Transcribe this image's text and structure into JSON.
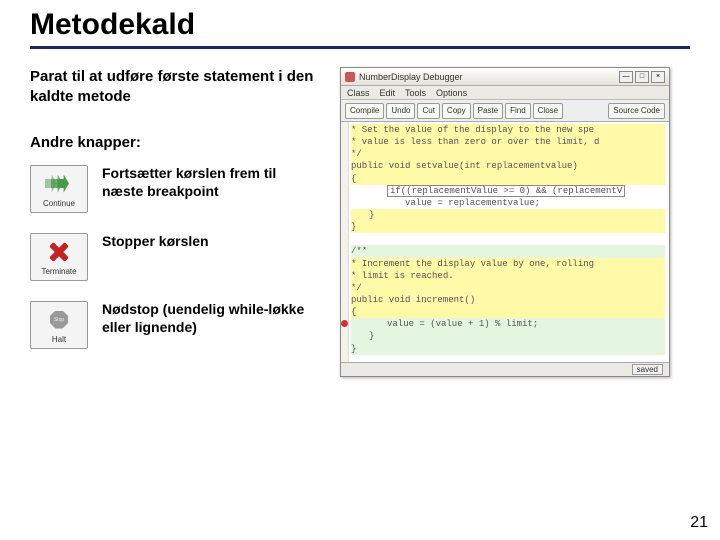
{
  "title": "Metodekald",
  "intro": "Parat til at udføre første statement i den kaldte metode",
  "sub_heading": "Andre knapper:",
  "buttons": {
    "continue": {
      "label": "Continue",
      "desc": "Fortsætter kørslen frem til næste breakpoint"
    },
    "terminate": {
      "label": "Terminate",
      "desc": "Stopper kørslen"
    },
    "halt": {
      "stop_text": "Stop",
      "label": "Halt",
      "desc": "Nødstop (uendelig while-løkke eller lignende)"
    }
  },
  "debugger": {
    "title": "NumberDisplay   Debugger",
    "window_buttons": {
      "min": "—",
      "max": "□",
      "close": "×"
    },
    "menu": [
      "Class",
      "Edit",
      "Tools",
      "Options"
    ],
    "toolbar": [
      "Compile",
      "Undo",
      "Cut",
      "Copy",
      "Paste",
      "Find",
      "Close"
    ],
    "source_button": "Source Code",
    "code_lines": [
      {
        "text": " * Set the value of the display to the new spe",
        "cls": "hl-yellow"
      },
      {
        "text": " * value is less than zero or over the limit, d",
        "cls": "hl-yellow"
      },
      {
        "text": " */",
        "cls": "hl-yellow"
      },
      {
        "text": "public void setvalue(int replacementvalue)",
        "cls": "hl-yellow"
      },
      {
        "text": "{",
        "cls": "hl-yellow"
      },
      {
        "text": "if((replacementValue >= 0) && (replacementV",
        "cls": "indent2 current-line"
      },
      {
        "text": "value = replacementvalue;",
        "cls": "indent3"
      },
      {
        "text": "}",
        "cls": "hl-yellow indent1"
      },
      {
        "text": "}",
        "cls": "hl-yellow"
      },
      {
        "text": "",
        "cls": ""
      },
      {
        "text": "/**",
        "cls": "hl-green"
      },
      {
        "text": " * Increment the display value by one, rolling",
        "cls": "hl-yellow"
      },
      {
        "text": " * limit is reached.",
        "cls": "hl-yellow"
      },
      {
        "text": " */",
        "cls": "hl-yellow"
      },
      {
        "text": "public void increment()",
        "cls": "hl-yellow"
      },
      {
        "text": "{",
        "cls": "hl-yellow"
      },
      {
        "text": "value = (value + 1) % limit;",
        "cls": "indent2 hl-green bp-row"
      },
      {
        "text": "}",
        "cls": "hl-green indent1"
      },
      {
        "text": "}",
        "cls": "hl-green"
      }
    ],
    "status": "saved"
  },
  "page_number": "21"
}
